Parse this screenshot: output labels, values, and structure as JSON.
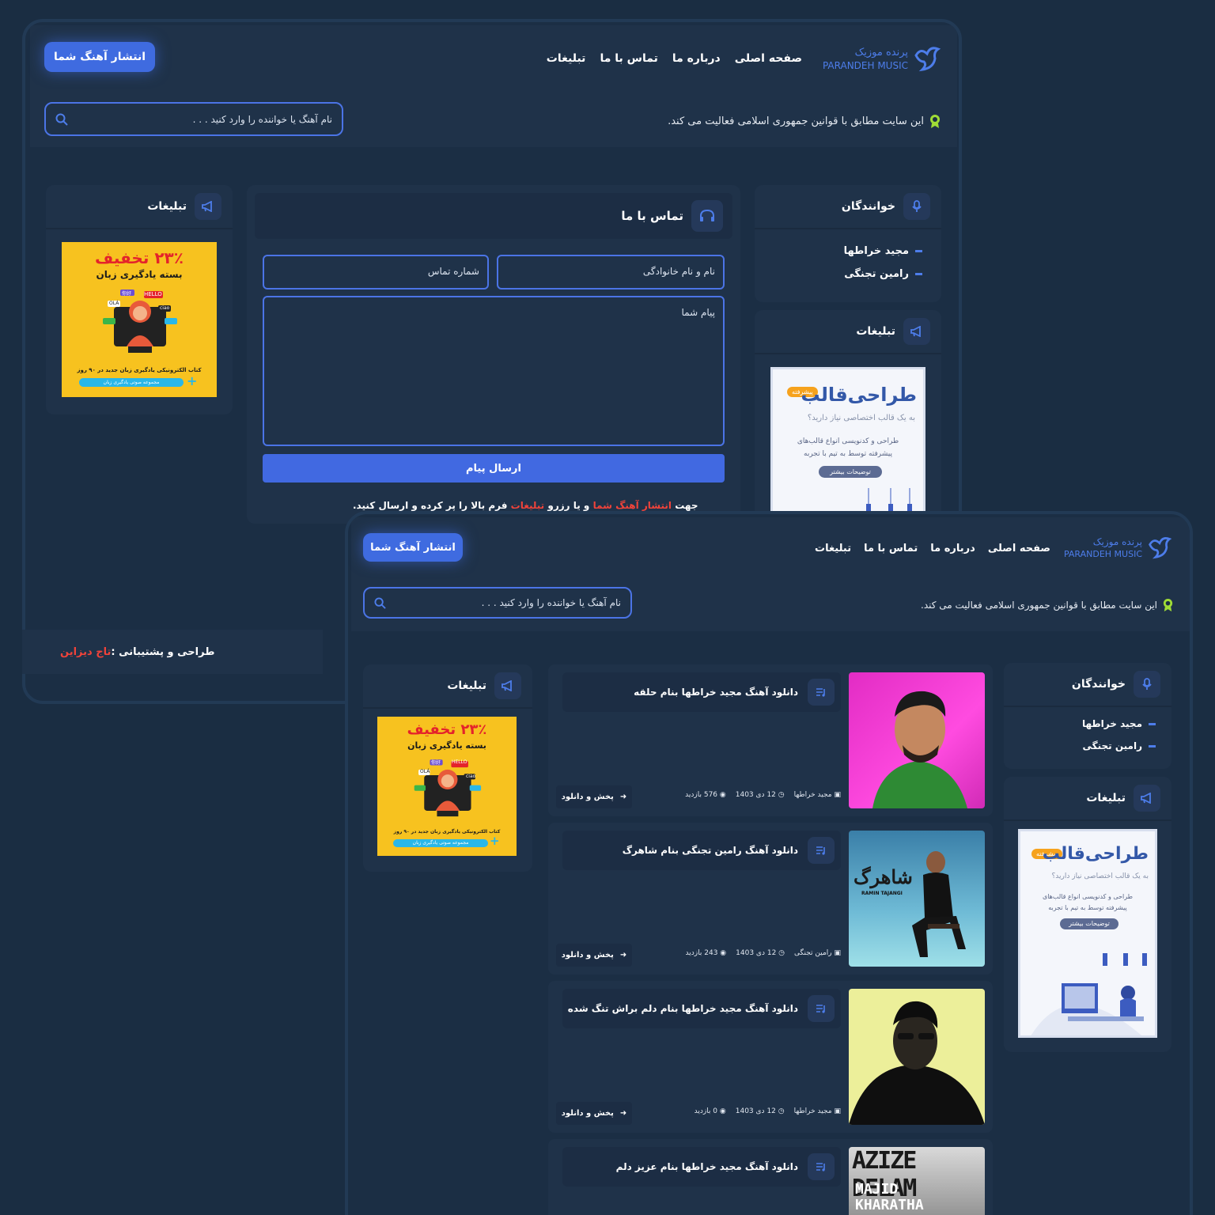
{
  "brand": {
    "name_fa": "پرنده موزیک",
    "name_en": "PARANDEH MUSIC"
  },
  "nav": [
    "صفحه اصلی",
    "درباره ما",
    "تماس با ما",
    "تبلیغات"
  ],
  "cta": "انتشار آهنگ شما",
  "search": {
    "placeholder": "نام آهنگ یا خواننده را وارد کنید . . ."
  },
  "legal_notice": "این سایت مطابق با قوانین جمهوری اسلامی فعالیت می کند.",
  "singers": {
    "title": "خوانندگان",
    "items": [
      "مجید خراطها",
      "رامین تجنگی"
    ]
  },
  "ads": {
    "title": "تبلیغات"
  },
  "contact": {
    "title": "تماس با ما",
    "name_placeholder": "نام و نام خانوادگی",
    "phone_placeholder": "شماره تماس",
    "message_placeholder": "پیام شما",
    "send": "ارسال پیام",
    "note": {
      "p1": "جهت ",
      "l1": "انتشار آهنگ شما",
      "p2": " و یا رزرو ",
      "l2": "تبلیغات",
      "p3": " فرم بالا را پر کرده و ارسال کنید."
    }
  },
  "ad_language": {
    "discount": "۲۳٪ تخفیف",
    "line1": "بسته یادگیری زبان",
    "line2": "کتاب الکترونیکی یادگیری زبان جدید در ۹۰ روز",
    "line3": "مجموعه صوتی یادگیری زبان",
    "bubbles": [
      "HELLO",
      "OLÁ",
      "你好",
      "ciao"
    ]
  },
  "ad_template": {
    "badge": "پیشرفته",
    "title": "طراحی‌قالب",
    "sub": "به یک قالب اختصاصی نیاز دارید؟",
    "desc1": "طراحی و کدنویسی انواع قالب‌های",
    "desc2": "پیشرفته توسط به تیم با تجربه",
    "btn": "توضیحات بیشتر"
  },
  "footer": {
    "label": "طراحی و پشتیبانی : ",
    "brand": "تاج دیزاین"
  },
  "songs": [
    {
      "title": "دانلود آهنگ مجید خراطها بنام حلقه",
      "artist": "مجید خراطها",
      "date": "12 دی 1403",
      "views": "576 بازدید",
      "play": "پخش و دانلود"
    },
    {
      "title": "دانلود آهنگ رامین تجنگی بنام شاهرگ",
      "artist": "رامین تجنگی",
      "date": "12 دی 1403",
      "views": "243 بازدید",
      "play": "پخش و دانلود",
      "cover_text": "شاهرگ",
      "cover_name": "RAMIN TAJANGI"
    },
    {
      "title": "دانلود آهنگ مجید خراطها بنام دلم براش تنگ شده",
      "artist": "مجید خراطها",
      "date": "12 دی 1403",
      "views": "0 بازدید",
      "play": "پخش و دانلود"
    },
    {
      "title": "دانلود آهنگ مجید خراطها بنام عزیز دلم",
      "cover_text": "AZIZE DELAM",
      "cover_name": "MAJID KHARATHA"
    }
  ],
  "colors": {
    "bg": "#1a2d42",
    "panel": "#1f3249",
    "accent": "#4169e1",
    "highlight": "#f0433a",
    "ad_yellow": "#f7c21f"
  }
}
